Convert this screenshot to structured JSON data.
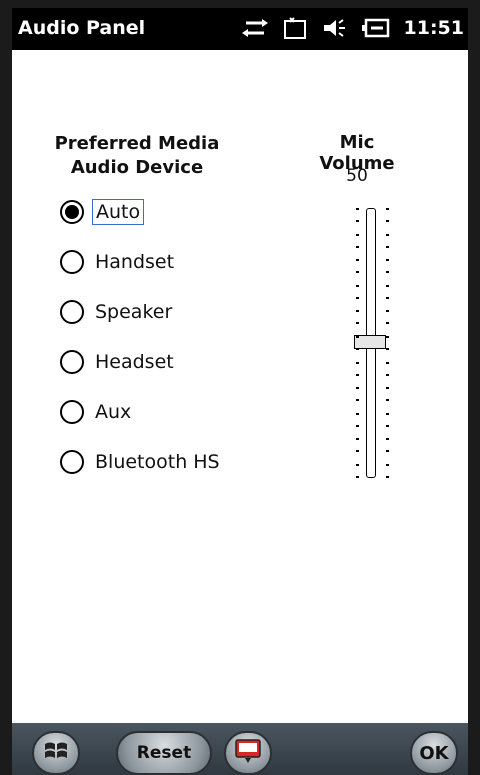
{
  "titlebar": {
    "title": "Audio Panel",
    "time": "11:51",
    "icons": [
      "data-sync-icon",
      "battery-empty-icon",
      "speaker-volume-icon",
      "battery-charging-icon"
    ]
  },
  "left": {
    "title_line1": "Preferred Media",
    "title_line2": "Audio Device",
    "options": [
      "Auto",
      "Handset",
      "Speaker",
      "Headset",
      "Aux",
      "Bluetooth HS"
    ],
    "selected": "Auto"
  },
  "right": {
    "title": "Mic Volume",
    "value": "50",
    "slider_level_percent": 50
  },
  "bottom": {
    "reset_label": "Reset",
    "ok_label": "OK",
    "icons": [
      "windows-start-icon",
      "keyboard-icon"
    ]
  },
  "colors": {
    "titlebar_bg": "#000000",
    "focus_border": "#3a6fd0"
  }
}
